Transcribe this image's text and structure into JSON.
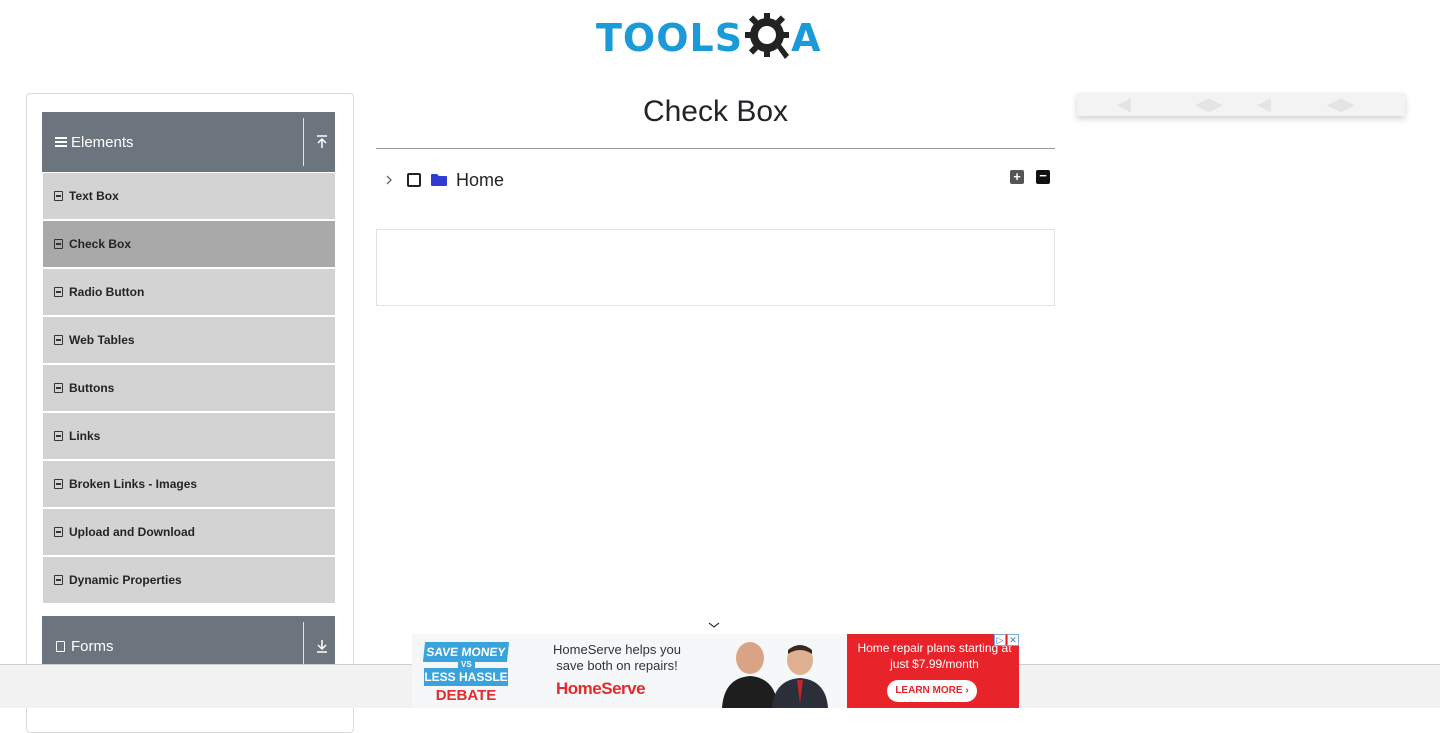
{
  "brand": {
    "logo_text": "TOOLS",
    "logo_suffix": "A"
  },
  "sidebar": {
    "groups": [
      {
        "label": "Elements",
        "icon": "menu-icon",
        "toggle_icon": "collapse-up-icon"
      },
      {
        "label": "Forms",
        "icon": "form-icon",
        "toggle_icon": "expand-down-icon"
      }
    ],
    "items": [
      {
        "label": "Text Box"
      },
      {
        "label": "Check Box",
        "active": true
      },
      {
        "label": "Radio Button"
      },
      {
        "label": "Web Tables"
      },
      {
        "label": "Buttons"
      },
      {
        "label": "Links"
      },
      {
        "label": "Broken Links - Images"
      },
      {
        "label": "Upload and Download"
      },
      {
        "label": "Dynamic Properties"
      }
    ]
  },
  "main": {
    "title": "Check Box",
    "tree": {
      "root_label": "Home",
      "checked": false,
      "expanded": false,
      "expand_all_label": "+",
      "collapse_all_label": "−"
    }
  },
  "ad": {
    "badge_top": "SAVE MONEY",
    "badge_vs": "VS",
    "badge_bottom": "LESS HASSLE",
    "headline": "DEBATE",
    "copy": "HomeServe helps you save both on repairs!",
    "brand": "HomeServe",
    "offer": "Home repair plans starting at just $7.99/month",
    "cta": "LEARN MORE ›"
  },
  "colors": {
    "accent": "#1a9bd7",
    "sidebar_header": "#6c757d",
    "menu_item": "#d3d3d3",
    "menu_item_active": "#a9a9a9",
    "folder": "#2f3bd1",
    "ad_red": "#e8232a"
  }
}
